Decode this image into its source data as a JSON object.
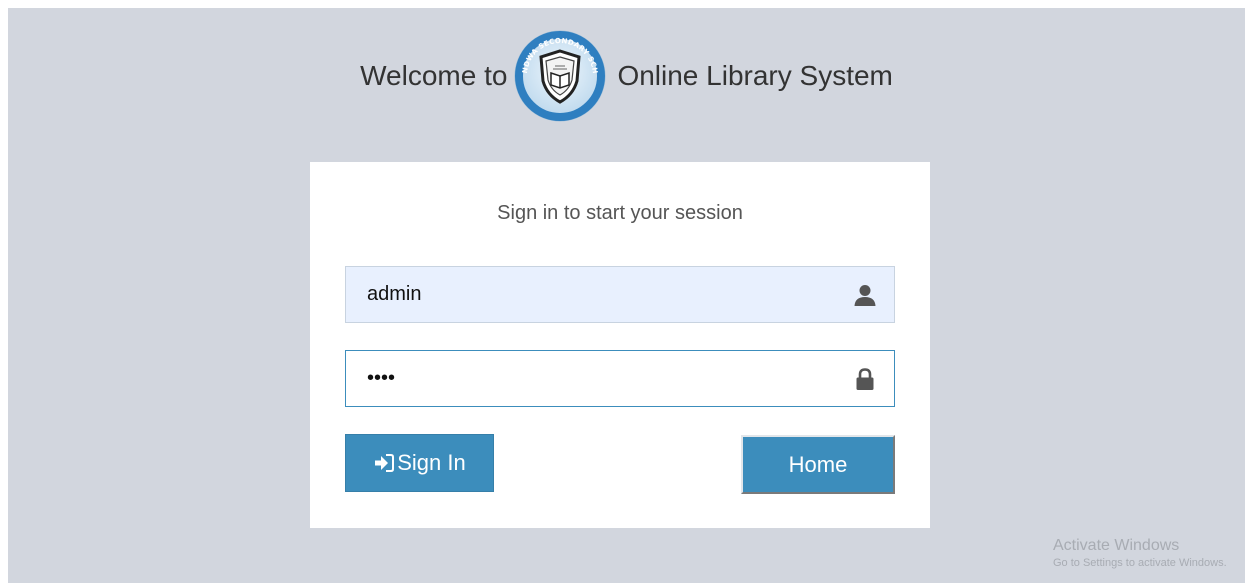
{
  "header": {
    "welcome_text": "Welcome to",
    "system_name": "Online Library System",
    "logo_text": "LWANDWA SECONDARY SCHOOL"
  },
  "login": {
    "message": "Sign in to start your session",
    "username": {
      "value": "admin",
      "icon": "user-icon"
    },
    "password": {
      "value": "1234",
      "icon": "lock-icon"
    },
    "signin_label": "Sign In",
    "signin_icon": "sign-in-icon",
    "home_label": "Home"
  },
  "watermark": {
    "title": "Activate Windows",
    "subtitle": "Go to Settings to activate Windows."
  },
  "colors": {
    "page_background": "#d2d6de",
    "primary": "#3c8dbc",
    "autofill": "#e8f0fe"
  }
}
